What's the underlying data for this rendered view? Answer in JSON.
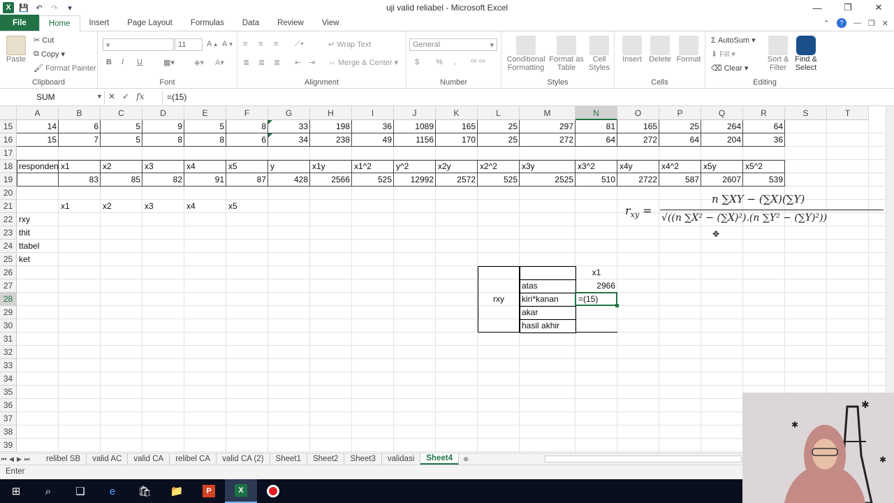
{
  "window": {
    "title": "uji valid reliabel - Microsoft Excel"
  },
  "tabs": [
    "File",
    "Home",
    "Insert",
    "Page Layout",
    "Formulas",
    "Data",
    "Review",
    "View"
  ],
  "ribbon": {
    "clipboard": {
      "label": "Clipboard",
      "paste": "Paste",
      "cut": "Cut",
      "copy": "Copy",
      "format_painter": "Format Painter"
    },
    "font": {
      "label": "Font",
      "size": "11",
      "bold": "B",
      "italic": "I",
      "underline": "U"
    },
    "alignment": {
      "label": "Alignment",
      "wrap": "Wrap Text",
      "merge": "Merge & Center"
    },
    "number": {
      "label": "Number",
      "format": "General",
      "currency": "$",
      "percent": "%",
      "comma": ","
    },
    "styles": {
      "label": "Styles",
      "conditional": "Conditional Formatting",
      "format_table": "Format as Table",
      "cell_styles": "Cell Styles"
    },
    "cells": {
      "label": "Cells",
      "insert": "Insert",
      "delete": "Delete",
      "format": "Format"
    },
    "editing": {
      "label": "Editing",
      "autosum": "AutoSum",
      "fill": "Fill",
      "clear": "Clear",
      "sort": "Sort & Filter",
      "find": "Find & Select"
    }
  },
  "formula_bar": {
    "name_box": "SUM",
    "cancel": "✕",
    "enter": "✓",
    "fx": "fx",
    "content": "=(15)"
  },
  "columns": [
    "A",
    "B",
    "C",
    "D",
    "E",
    "F",
    "G",
    "H",
    "I",
    "J",
    "K",
    "L",
    "M",
    "N",
    "O",
    "P",
    "Q",
    "R",
    "S",
    "T"
  ],
  "rows": [
    "15",
    "16",
    "17",
    "18",
    "19",
    "20",
    "21",
    "22",
    "23",
    "24",
    "25",
    "26",
    "27",
    "28",
    "29",
    "30",
    "31",
    "32",
    "33",
    "34",
    "35",
    "36",
    "37",
    "38",
    "39"
  ],
  "row15": [
    "14",
    "6",
    "5",
    "9",
    "5",
    "8",
    "33",
    "198",
    "36",
    "1089",
    "165",
    "25",
    "297",
    "81",
    "165",
    "25",
    "264",
    "64"
  ],
  "row16": [
    "15",
    "7",
    "5",
    "8",
    "8",
    "6",
    "34",
    "238",
    "49",
    "1156",
    "170",
    "25",
    "272",
    "64",
    "272",
    "64",
    "204",
    "36"
  ],
  "row18": [
    "responden",
    "x1",
    "x2",
    "x3",
    "x4",
    "x5",
    "y",
    "x1y",
    "x1^2",
    "y^2",
    "x2y",
    "x2^2",
    "x3y",
    "x3^2",
    "x4y",
    "x4^2",
    "x5y",
    "x5^2"
  ],
  "row19": [
    "83",
    "85",
    "82",
    "91",
    "87",
    "428",
    "2566",
    "525",
    "12992",
    "2572",
    "525",
    "2525",
    "510",
    "2722",
    "587",
    "2607",
    "539"
  ],
  "row21": [
    "x1",
    "x2",
    "x3",
    "x4",
    "x5"
  ],
  "labels": {
    "rxy": "rxy",
    "thit": "thit",
    "ttabel": "ttabel",
    "ket": "ket"
  },
  "calc_table": {
    "rxy": "rxy",
    "header": "x1",
    "atas": "atas",
    "atas_val": "2966",
    "kiri": "kiri*kanan",
    "kiri_val": "=(15)",
    "akar": "akar",
    "hasil": "hasil akhir"
  },
  "formula_image": {
    "lhs": "r",
    "lhs_sub": "xy",
    "numerator": "n ∑XY − (∑X)(∑Y)",
    "denominator": "√((n ∑X² − (∑X)²).(n ∑Y² − (∑Y)²))"
  },
  "sheets": [
    "relibel SB",
    "valid AC",
    "valid CA",
    "relibel CA",
    "valid CA (2)",
    "Sheet1",
    "Sheet2",
    "Sheet3",
    "validasi",
    "Sheet4"
  ],
  "active_sheet": "Sheet4",
  "status": "Enter"
}
